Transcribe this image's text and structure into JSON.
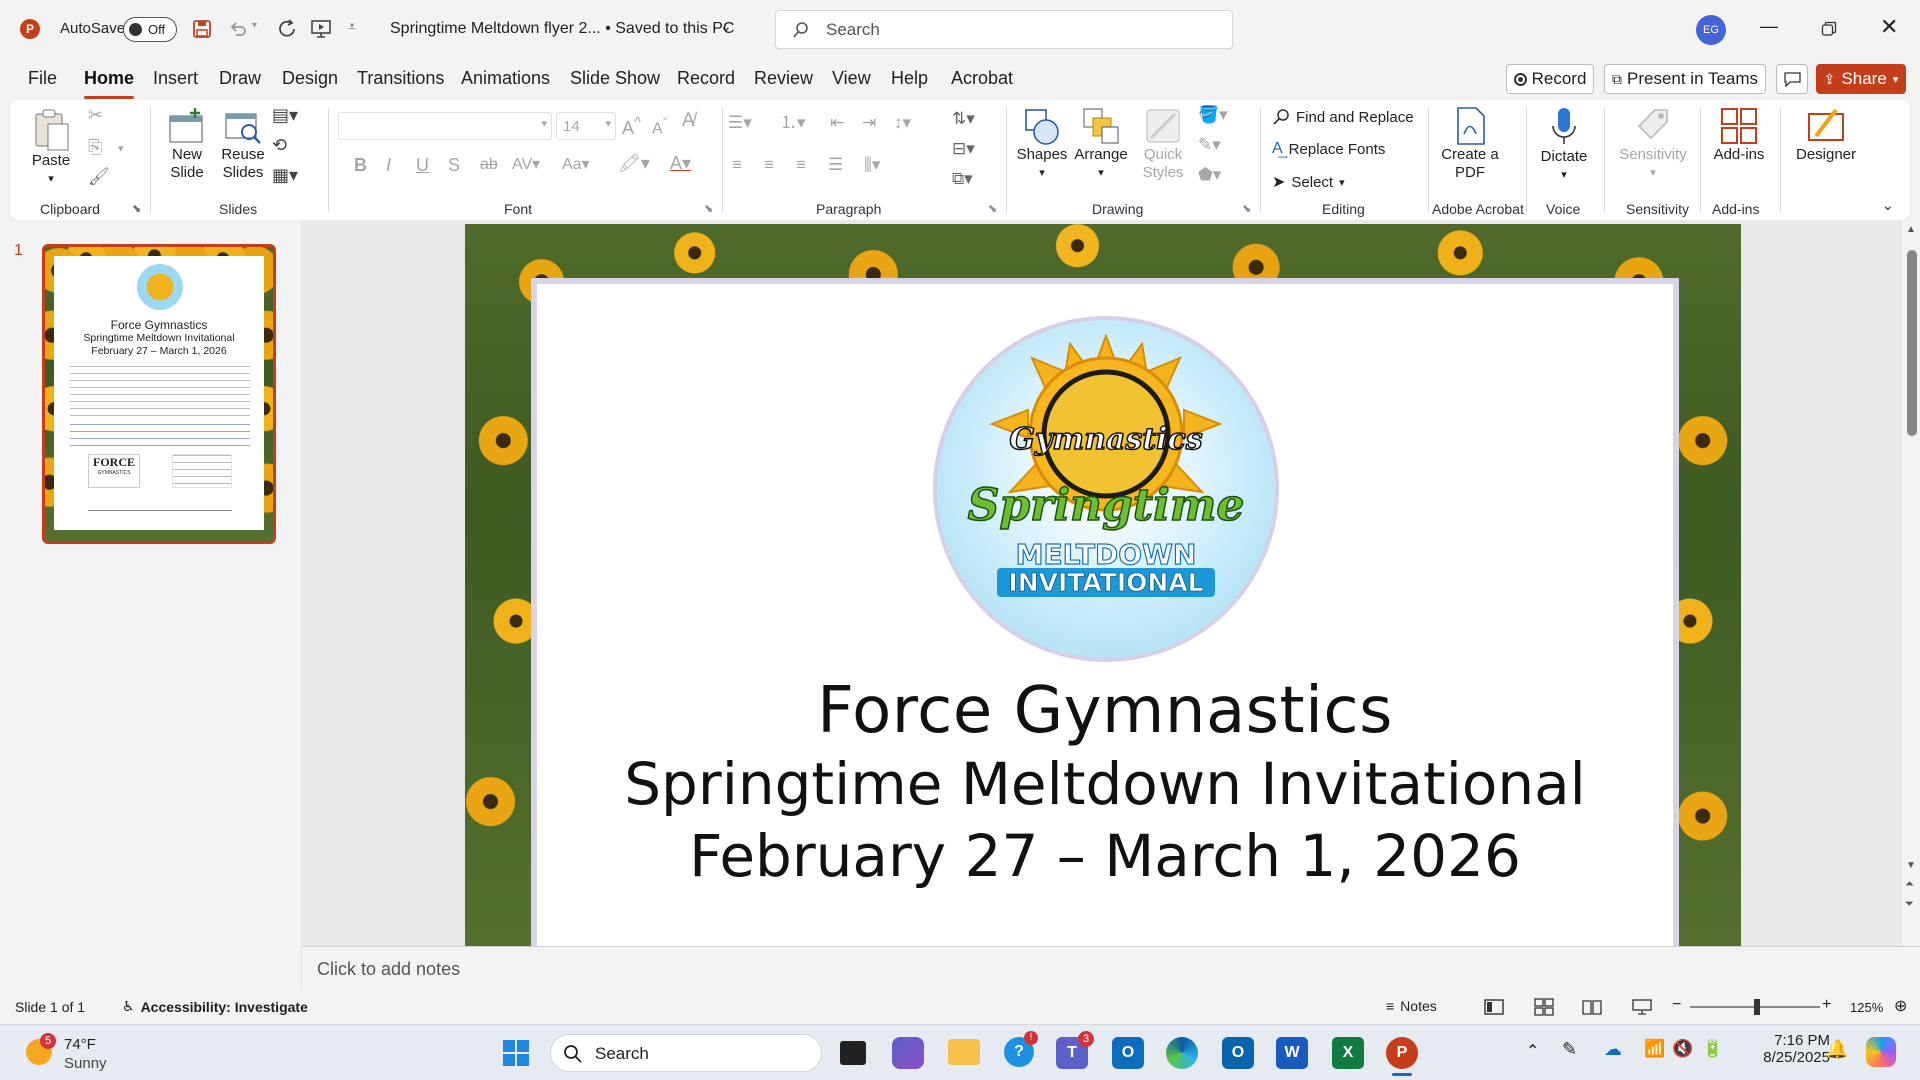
{
  "app": {
    "autosave_label": "AutoSave",
    "autosave_state": "Off",
    "doc_title": "Springtime Meltdown flyer 2... • Saved to this PC",
    "search_placeholder": "Search",
    "user_initials": "EG"
  },
  "tabs": [
    "File",
    "Home",
    "Insert",
    "Draw",
    "Design",
    "Transitions",
    "Animations",
    "Slide Show",
    "Record",
    "Review",
    "View",
    "Help",
    "Acrobat"
  ],
  "top_actions": {
    "record": "Record",
    "present_teams": "Present in Teams",
    "share": "Share"
  },
  "ribbon": {
    "clipboard": {
      "paste": "Paste",
      "label": "Clipboard"
    },
    "slides": {
      "new_slide": "New Slide",
      "reuse_slides": "Reuse Slides",
      "label": "Slides"
    },
    "font": {
      "size": "14",
      "label": "Font"
    },
    "paragraph": {
      "label": "Paragraph"
    },
    "drawing": {
      "shapes": "Shapes",
      "arrange": "Arrange",
      "quick_styles": "Quick Styles",
      "label": "Drawing"
    },
    "editing": {
      "find_replace": "Find and Replace",
      "replace_fonts": "Replace Fonts",
      "select": "Select",
      "label": "Editing"
    },
    "acrobat": {
      "create_pdf": "Create a PDF",
      "label": "Adobe Acrobat"
    },
    "voice": {
      "dictate": "Dictate",
      "label": "Voice"
    },
    "sensitivity": {
      "sensitivity": "Sensitivity",
      "label": "Sensitivity"
    },
    "addins": {
      "addins": "Add-ins",
      "label": "Add-ins"
    },
    "designer": {
      "designer": "Designer"
    }
  },
  "thumbnail": {
    "number": "1",
    "title1": "Force Gymnastics",
    "title2": "Springtime Meltdown Invitational",
    "title3": "February 27 – March 1, 2026",
    "force_logo": "FORCE",
    "force_sub": "GYMNASTICS"
  },
  "slide": {
    "logo_top": "Gymnastics",
    "logo_mid": "Springtime",
    "logo_bot1": "MELTDOWN",
    "logo_bot2": "INVITATIONAL",
    "line1": "Force Gymnastics",
    "line2": "Springtime Meltdown Invitational",
    "line3": "February 27 – March 1, 2026"
  },
  "notes_placeholder": "Click to add notes",
  "status": {
    "slide_count": "Slide 1 of 1",
    "accessibility": "Accessibility: Investigate",
    "notes": "Notes",
    "zoom": "125%"
  },
  "taskbar": {
    "weather_temp": "74°F",
    "weather_desc": "Sunny",
    "weather_badge": "5",
    "search": "Search",
    "teams_badge": "3",
    "time": "7:16 PM",
    "date": "8/25/2025"
  },
  "colors": {
    "accent": "#c43e1c",
    "share_bg": "#c43e1c",
    "slide_border": "#d8d3e8"
  }
}
